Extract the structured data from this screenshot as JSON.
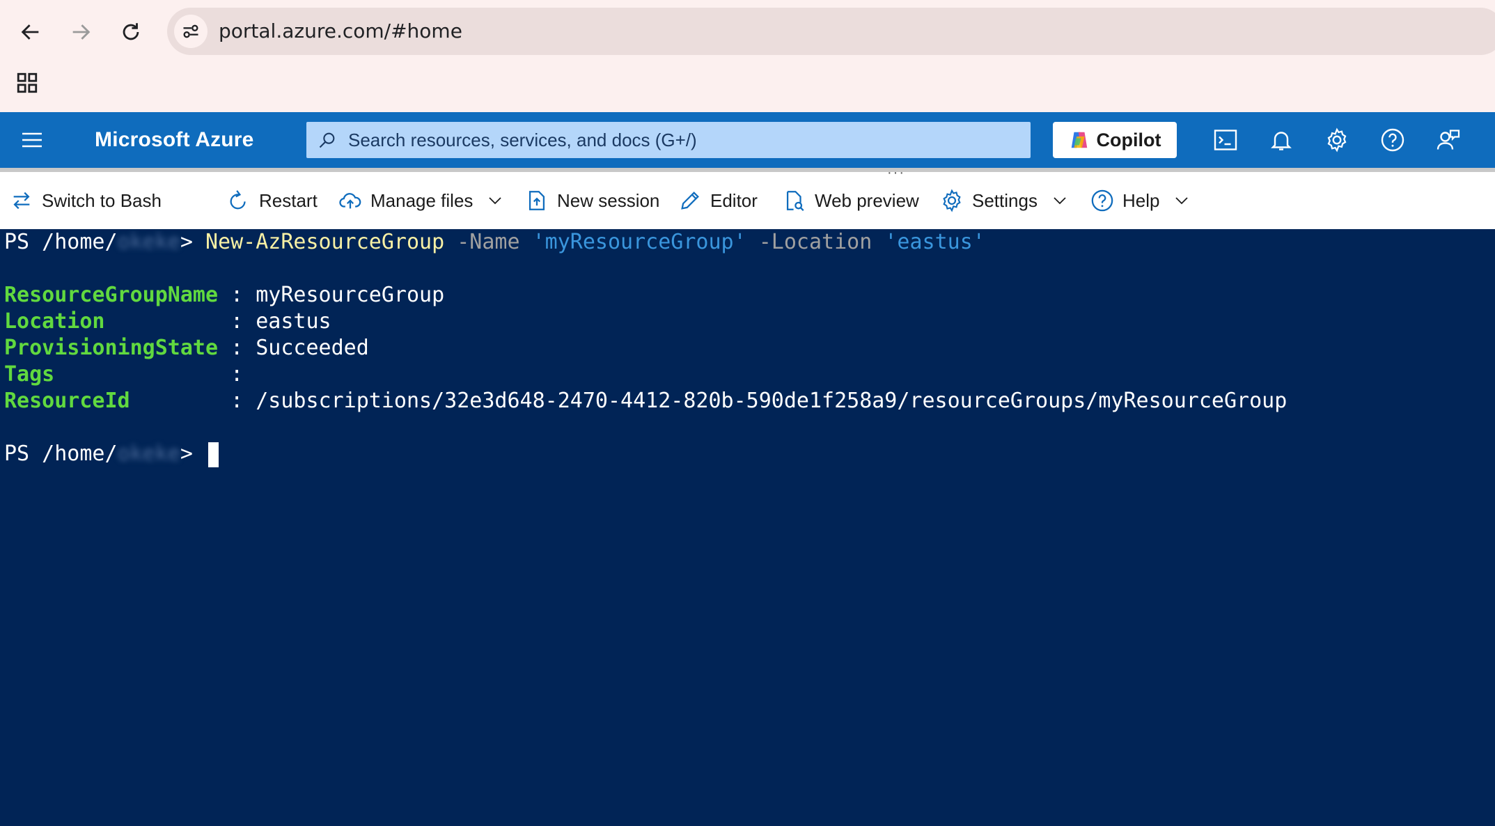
{
  "browser": {
    "url": "portal.azure.com/#home",
    "icons": [
      "back-icon",
      "forward-icon",
      "reload-icon",
      "site-info-icon",
      "apps-icon"
    ]
  },
  "header": {
    "brand": "Microsoft Azure",
    "search_placeholder": "Search resources, services, and docs (G+/)",
    "copilot_label": "Copilot",
    "icons": [
      "cloud-shell-icon",
      "bell-icon",
      "gear-icon",
      "help-icon",
      "feedback-icon"
    ]
  },
  "toolbar": {
    "switch": "Switch to Bash",
    "restart": "Restart",
    "manage_files": "Manage files",
    "new_session": "New session",
    "editor": "Editor",
    "web_preview": "Web preview",
    "settings": "Settings",
    "help": "Help"
  },
  "terminal": {
    "prompt_prefix": "PS /home/",
    "prompt_user": "okeke",
    "prompt_suffix": "> ",
    "command": "New-AzResourceGroup",
    "arg1_name": " -Name ",
    "arg1_value": "'myResourceGroup'",
    "arg2_name": " -Location ",
    "arg2_value": "'eastus'",
    "output": [
      {
        "key": "ResourceGroupName",
        "sep": " : ",
        "value": "myResourceGroup"
      },
      {
        "key": "Location         ",
        "sep": " : ",
        "value": "eastus"
      },
      {
        "key": "ProvisioningState",
        "sep": " : ",
        "value": "Succeeded"
      },
      {
        "key": "Tags             ",
        "sep": " : ",
        "value": ""
      },
      {
        "key": "ResourceId       ",
        "sep": " : ",
        "value": "/subscriptions/32e3d648-2470-4412-820b-590de1f258a9/resourceGroups/myResourceGroup"
      }
    ]
  },
  "colors": {
    "terminal_bg": "#012456",
    "azure_blue": "#0f6cbd",
    "command": "#f9f1a5",
    "string": "#3a96dd",
    "key": "#61d93f"
  }
}
